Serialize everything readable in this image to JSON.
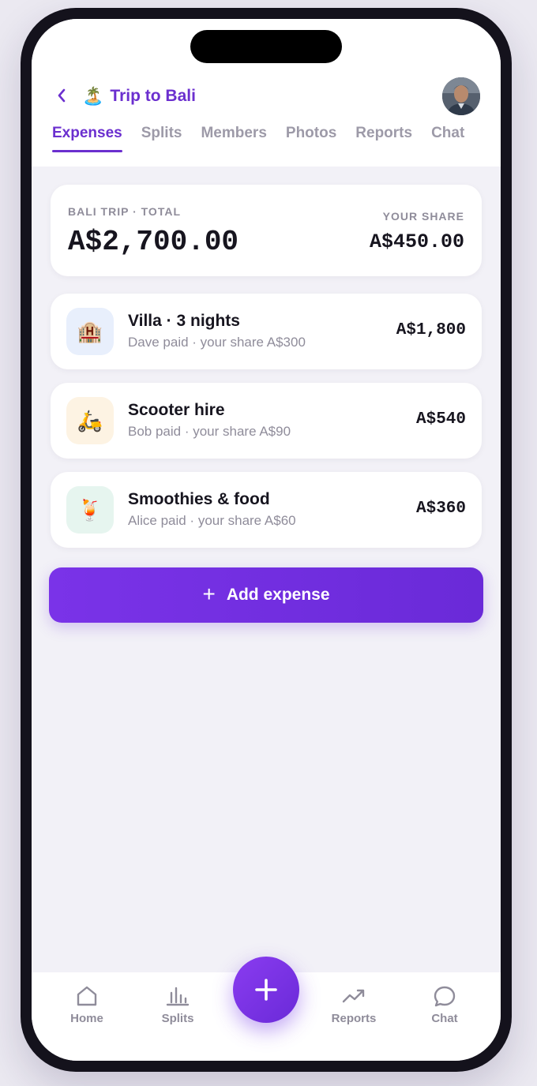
{
  "header": {
    "title_emoji": "🏝️",
    "title": "Trip to Bali"
  },
  "tabs": [
    {
      "label": "Expenses",
      "active": true
    },
    {
      "label": "Splits",
      "active": false
    },
    {
      "label": "Members",
      "active": false
    },
    {
      "label": "Photos",
      "active": false
    },
    {
      "label": "Reports",
      "active": false
    },
    {
      "label": "Chat",
      "active": false
    }
  ],
  "summary": {
    "total_label": "BALI TRIP · TOTAL",
    "total_value": "A$2,700.00",
    "share_label": "YOUR SHARE",
    "share_value": "A$450.00"
  },
  "expenses": [
    {
      "icon": "🏨",
      "icon_bg": "#e8effc",
      "title": "Villa · 3 nights",
      "subtitle": "Dave paid · your share A$300",
      "amount": "A$1,800"
    },
    {
      "icon": "🛵",
      "icon_bg": "#fdf3e3",
      "title": "Scooter hire",
      "subtitle": "Bob paid · your share A$90",
      "amount": "A$540"
    },
    {
      "icon": "🍹",
      "icon_bg": "#e6f5ef",
      "title": "Smoothies & food",
      "subtitle": "Alice paid · your share A$60",
      "amount": "A$360"
    }
  ],
  "add_button": {
    "plus": "+",
    "label": "Add expense"
  },
  "bottom_nav": [
    {
      "label": "Home",
      "icon": "home-icon"
    },
    {
      "label": "Splits",
      "icon": "bar-chart-icon"
    },
    {
      "label": "Reports",
      "icon": "trend-up-icon"
    },
    {
      "label": "Chat",
      "icon": "chat-bubble-icon"
    }
  ],
  "colors": {
    "accent": "#6b2fcf",
    "muted": "#8f8c9a",
    "background": "#f2f1f7"
  }
}
